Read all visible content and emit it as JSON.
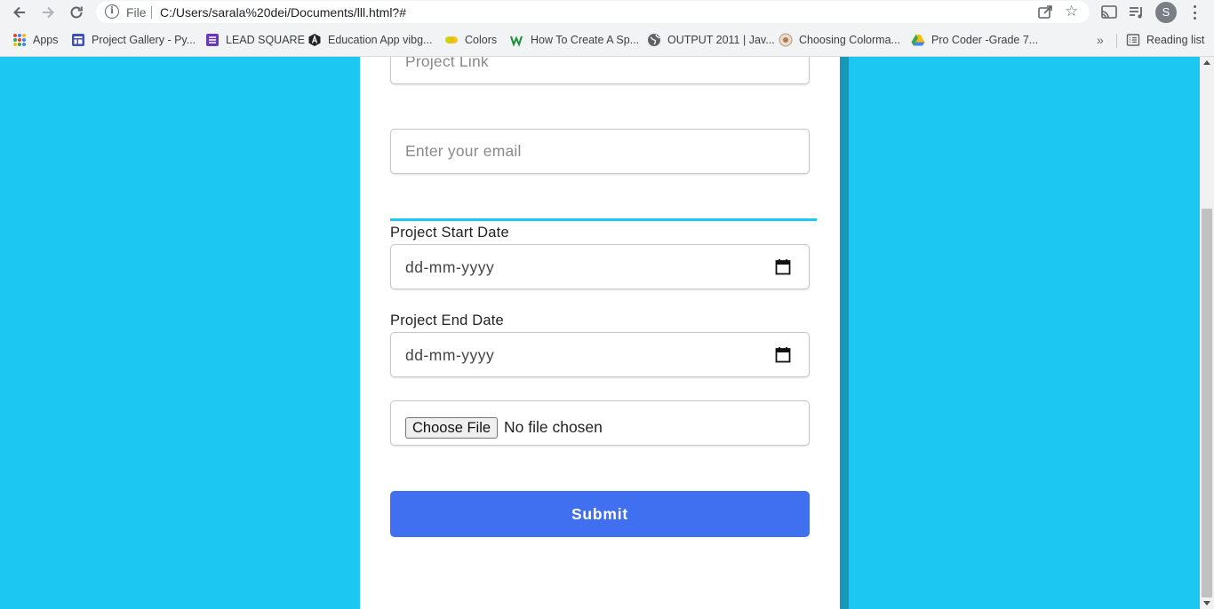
{
  "browser": {
    "omnibox": {
      "scheme_label": "File",
      "url": "C:/Users/sarala%20dei/Documents/lll.html?#"
    },
    "profile_initial": "S",
    "bookmarks": [
      {
        "label": "Apps",
        "icon": "apps-grid-icon"
      },
      {
        "label": "Project Gallery - Py...",
        "icon": "project-gallery-icon"
      },
      {
        "label": "LEAD SQUARE",
        "icon": "lead-square-icon"
      },
      {
        "label": "Education App vibg...",
        "icon": "education-app-icon"
      },
      {
        "label": "Colors",
        "icon": "colors-icon"
      },
      {
        "label": "How To Create A Sp...",
        "icon": "w-icon"
      },
      {
        "label": "OUTPUT 2011 | Jav...",
        "icon": "globe-icon"
      },
      {
        "label": "Choosing Colorma...",
        "icon": "colormap-icon"
      },
      {
        "label": "Pro Coder -Grade 7...",
        "icon": "google-drive-icon"
      }
    ],
    "more_label": "»",
    "reading_list_label": "Reading list"
  },
  "form": {
    "project_link_placeholder": "Project Link",
    "email_placeholder": "Enter your email",
    "start_date_label": "Project Start Date",
    "start_date_placeholder": "dd-mm-yyyy",
    "end_date_label": "Project End Date",
    "end_date_placeholder": "dd-mm-yyyy",
    "choose_file_label": "Choose File",
    "no_file_label": "No file chosen",
    "submit_label": "Submit"
  },
  "colors": {
    "page_background": "#1cc8f2",
    "card_background": "#ffffff",
    "submit_button": "#4070f0",
    "accent_line": "#1cc8f2"
  }
}
